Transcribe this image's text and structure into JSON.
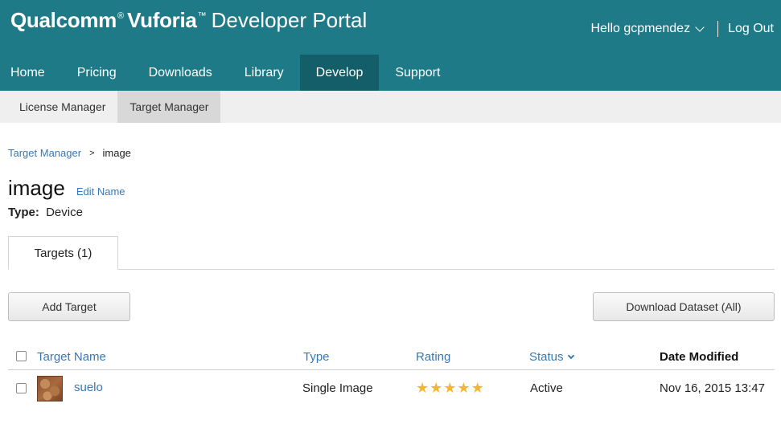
{
  "header": {
    "brand_qualcomm": "Qualcomm",
    "brand_reg": "®",
    "brand_vuforia": "Vuforia",
    "brand_tm": "™",
    "brand_suffix": "Developer Portal",
    "greeting": "Hello gcpmendez",
    "logout": "Log Out",
    "background_color": "#1f7a87",
    "active_nav_color": "#135e68"
  },
  "nav": {
    "items": [
      {
        "label": "Home"
      },
      {
        "label": "Pricing"
      },
      {
        "label": "Downloads"
      },
      {
        "label": "Library"
      },
      {
        "label": "Develop"
      },
      {
        "label": "Support"
      }
    ],
    "active": "Develop"
  },
  "subnav": {
    "items": [
      {
        "label": "License Manager"
      },
      {
        "label": "Target Manager"
      }
    ],
    "active": "Target Manager"
  },
  "breadcrumb": {
    "parent": "Target Manager",
    "separator": ">",
    "current": "image"
  },
  "page": {
    "title": "image",
    "edit_name": "Edit Name",
    "type_label": "Type:",
    "type_value": "Device"
  },
  "tabs": {
    "targets": "Targets (1)"
  },
  "actions": {
    "add_target": "Add Target",
    "download_dataset": "Download Dataset (All)"
  },
  "table": {
    "columns": {
      "name": "Target Name",
      "type": "Type",
      "rating": "Rating",
      "status": "Status",
      "date": "Date Modified"
    },
    "rows": [
      {
        "name": "suelo",
        "type": "Single Image",
        "rating": 5,
        "rating_max": 5,
        "status": "Active",
        "date": "Nov 16, 2015 13:47",
        "thumbnail_icon": "dry-soil-thumbnail"
      }
    ]
  },
  "colors": {
    "link": "#3a78b5",
    "star": "#f5b733"
  }
}
